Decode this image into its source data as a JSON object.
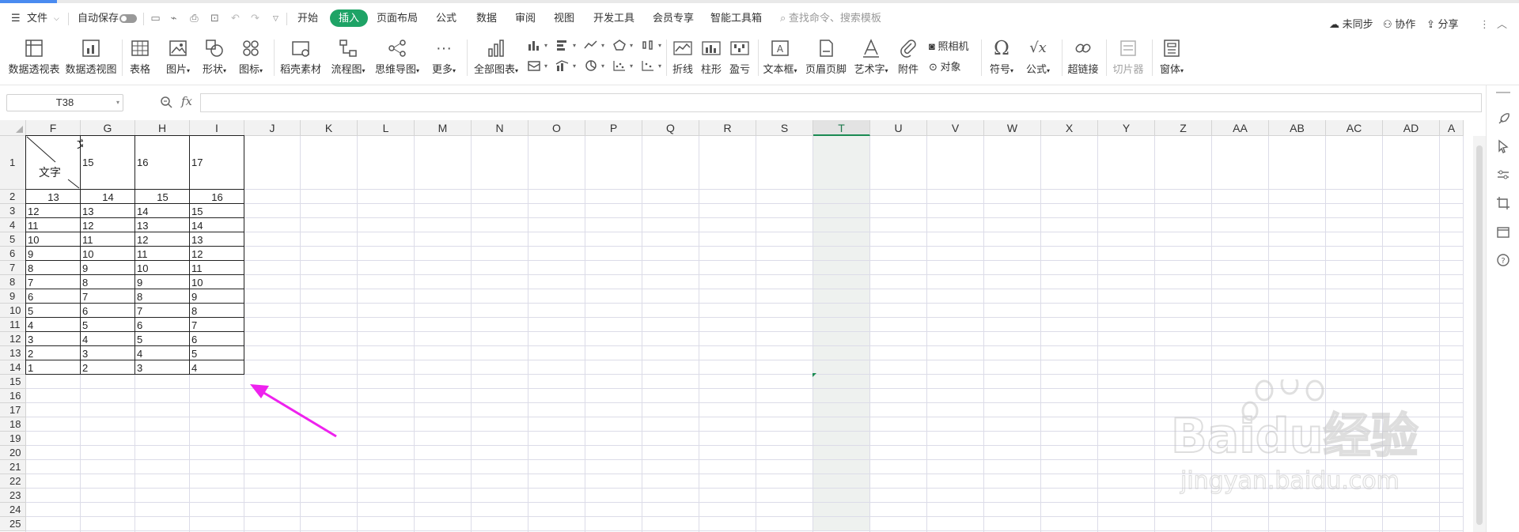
{
  "menu": {
    "file": "文件",
    "autosave": "自动保存",
    "tabs": [
      "开始",
      "插入",
      "页面布局",
      "公式",
      "数据",
      "审阅",
      "视图",
      "开发工具",
      "会员专享",
      "智能工具箱"
    ],
    "active_tab": "插入",
    "search_placeholder": "查找命令、搜索模板",
    "sync": "未同步",
    "collab": "协作",
    "share": "分享"
  },
  "ribbon": {
    "pivot_table": "数据透视表",
    "pivot_chart": "数据透视图",
    "table": "表格",
    "picture": "图片",
    "shape": "形状",
    "icon": "图标",
    "material": "稻壳素材",
    "flowchart": "流程图",
    "mindmap": "思维导图",
    "more": "更多",
    "all_charts": "全部图表",
    "sparkline_line": "折线",
    "sparkline_bar": "柱形",
    "sparkline_winloss": "盈亏",
    "textbox": "文本框",
    "header_footer": "页眉页脚",
    "wordart": "艺术字",
    "attachment": "附件",
    "camera": "照相机",
    "object": "对象",
    "symbol": "符号",
    "formula": "公式",
    "hyperlink": "超链接",
    "slicer": "切片器",
    "form": "窗体"
  },
  "formula_bar": {
    "name_box": "T38",
    "fx": "fx",
    "value": ""
  },
  "grid": {
    "columns": [
      "F",
      "G",
      "H",
      "I",
      "J",
      "K",
      "L",
      "M",
      "N",
      "O",
      "P",
      "Q",
      "R",
      "S",
      "T",
      "U",
      "V",
      "W",
      "X",
      "Y",
      "Z",
      "AA",
      "AB",
      "AC",
      "AD",
      "A"
    ],
    "selected_column": "T",
    "rows": [
      "1",
      "2",
      "3",
      "4",
      "5",
      "6",
      "7",
      "8",
      "9",
      "10",
      "11",
      "12",
      "13",
      "14",
      "15",
      "16",
      "17",
      "18",
      "19",
      "20",
      "21",
      "22",
      "23",
      "24",
      "25"
    ],
    "header_cell_text": "文字",
    "header_cell_partial": "文",
    "row1": [
      "15",
      "16",
      "17"
    ],
    "row2": [
      "13",
      "14",
      "15",
      "16"
    ],
    "data_rows": [
      [
        "12",
        "13",
        "14",
        "15"
      ],
      [
        "11",
        "12",
        "13",
        "14"
      ],
      [
        "10",
        "11",
        "12",
        "13"
      ],
      [
        "9",
        "10",
        "11",
        "12"
      ],
      [
        "8",
        "9",
        "10",
        "11"
      ],
      [
        "7",
        "8",
        "9",
        "10"
      ],
      [
        "6",
        "7",
        "8",
        "9"
      ],
      [
        "5",
        "6",
        "7",
        "8"
      ],
      [
        "4",
        "5",
        "6",
        "7"
      ],
      [
        "3",
        "4",
        "5",
        "6"
      ],
      [
        "2",
        "3",
        "4",
        "5"
      ],
      [
        "1",
        "2",
        "3",
        "4"
      ]
    ]
  },
  "colors": {
    "active_tab": "#1ea366",
    "selection": "#1a8a52",
    "arrow": "#ee22ee",
    "gridline": "#dcdce8"
  },
  "watermark": {
    "brand": "Baidu经验",
    "url": "jingyan.baidu.com"
  }
}
